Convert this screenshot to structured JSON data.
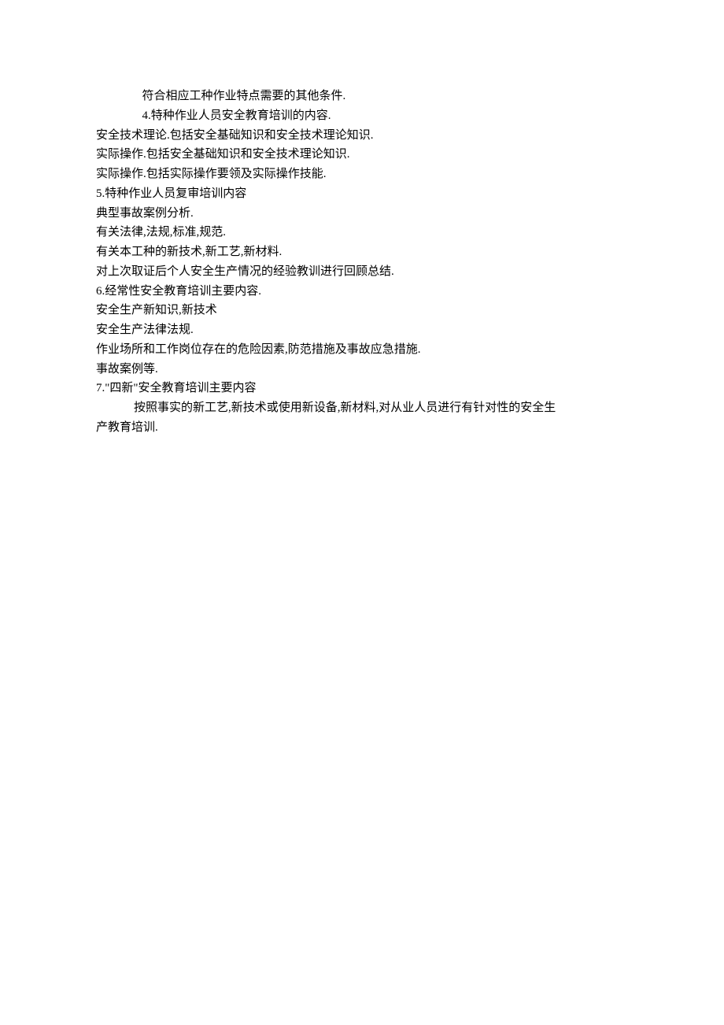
{
  "lines": [
    {
      "class": "indent1",
      "text": "符合相应工种作业特点需要的其他条件."
    },
    {
      "class": "indent1",
      "text": "4.特种作业人员安全教育培训的内容."
    },
    {
      "class": "no-indent",
      "text": "安全技术理论.包括安全基础知识和安全技术理论知识."
    },
    {
      "class": "no-indent",
      "text": "实际操作.包括安全基础知识和安全技术理论知识."
    },
    {
      "class": "no-indent",
      "text": "实际操作.包括实际操作要领及实际操作技能."
    },
    {
      "class": "no-indent",
      "text": "5.特种作业人员复审培训内容"
    },
    {
      "class": "no-indent",
      "text": "典型事故案例分析."
    },
    {
      "class": "no-indent",
      "text": "有关法律,法规,标准,规范."
    },
    {
      "class": "no-indent",
      "text": "有关本工种的新技术,新工艺,新材料."
    },
    {
      "class": "no-indent",
      "text": "对上次取证后个人安全生产情况的经验教训进行回顾总结."
    },
    {
      "class": "no-indent",
      "text": "6.经常性安全教育培训主要内容."
    },
    {
      "class": "no-indent",
      "text": "安全生产新知识,新技术"
    },
    {
      "class": "no-indent",
      "text": "安全生产法律法规."
    },
    {
      "class": "no-indent",
      "text": "作业场所和工作岗位存在的危险因素,防范措施及事故应急措施."
    },
    {
      "class": "no-indent",
      "text": "事故案例等."
    },
    {
      "class": "no-indent",
      "text": "7.\"四新\"安全教育培训主要内容"
    },
    {
      "class": "indent2",
      "text": "按照事实的新工艺,新技术或使用新设备,新材料,对从业人员进行有针对性的安全生"
    },
    {
      "class": "no-indent",
      "text": "产教育培训."
    }
  ]
}
